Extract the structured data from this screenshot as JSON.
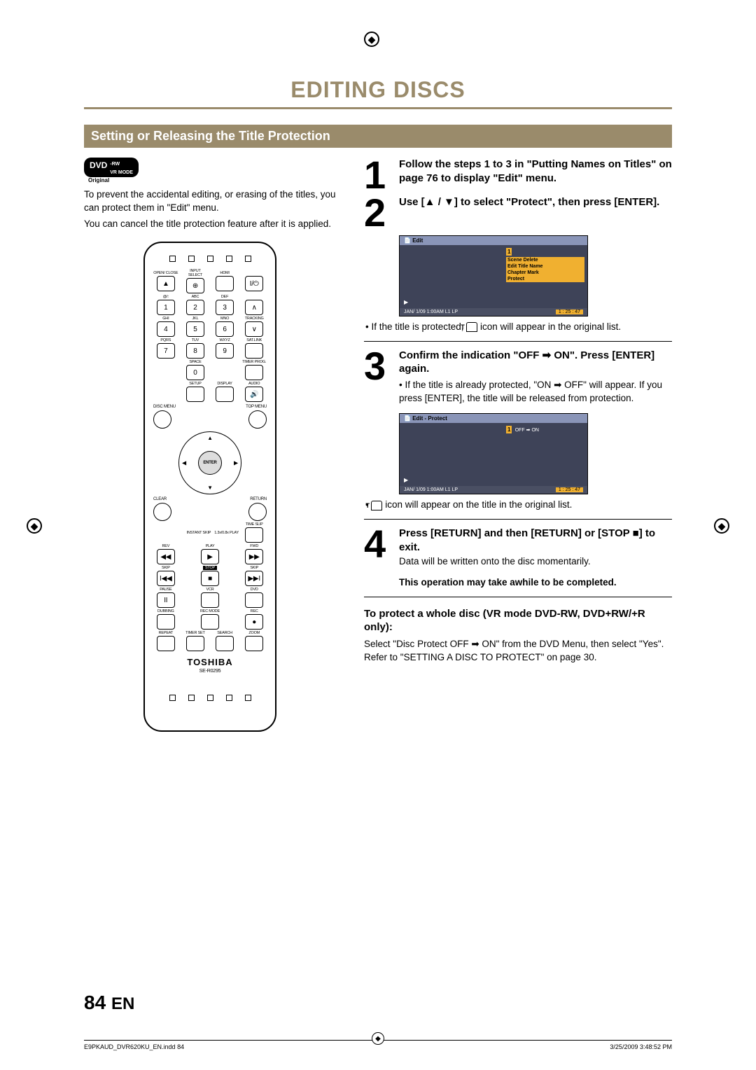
{
  "header": {
    "title": "EDITING DISCS"
  },
  "section_bar": "Setting or Releasing the Title Protection",
  "dvd_badge": {
    "top": "DVD",
    "mid": "-RW",
    "bot": "VR MODE",
    "sub": "Original"
  },
  "intro": {
    "p1": "To prevent the accidental editing, or erasing of the titles, you can protect them in \"Edit\" menu.",
    "p2": "You can cancel the title protection feature after it is applied."
  },
  "remote": {
    "row_labels": [
      "OPEN/\nCLOSE",
      "INPUT\nSELECT",
      "HDMI",
      ""
    ],
    "abc": [
      "@/:",
      "ABC",
      "DEF",
      ""
    ],
    "nums1": [
      "1",
      "2",
      "3"
    ],
    "ghi": [
      "GHI",
      "JKL",
      "MNO",
      "TRACKING"
    ],
    "nums2": [
      "4",
      "5",
      "6"
    ],
    "pqrs": [
      "PQRS",
      "TUV",
      "WXYZ",
      "SAT.LINK"
    ],
    "nums3": [
      "7",
      "8",
      "9"
    ],
    "zero_row": [
      "",
      "SPACE",
      "",
      "TIMER\nPROG."
    ],
    "zero": "0",
    "setup_row": [
      "",
      "SETUP",
      "DISPLAY",
      "AUDIO"
    ],
    "disc_menu": "DISC MENU",
    "top_menu": "TOP MENU",
    "enter": "ENTER",
    "clear": "CLEAR",
    "return": "RETURN",
    "instant": "INSTANT\nSKIP",
    "play13": "1.3x/0.8x\nPLAY",
    "timeslip": "TIME SLIP",
    "rev": "REV",
    "play": "PLAY",
    "fwd": "FWD",
    "skip1": "SKIP",
    "stop": "STOP",
    "skip2": "SKIP",
    "pause": "PAUSE",
    "vcr": "VCR",
    "dvd": "DVD",
    "dubbing": "DUBBING",
    "recmode": "REC MODE",
    "rec": "REC",
    "repeat": "REPEAT",
    "timerset": "TIMER SET",
    "search": "SEARCH",
    "zoom": "ZOOM",
    "brand": "TOSHIBA",
    "model": "SE-R0295"
  },
  "steps": [
    {
      "n": "1",
      "bold": "Follow the steps 1 to 3 in \"Putting Names on Titles\" on page 76 to display \"Edit\" menu."
    },
    {
      "n": "2",
      "bold": "Use [▲ / ▼] to select \"Protect\", then press [ENTER]."
    },
    {
      "n": "3",
      "bold": "Confirm the indication \"OFF ➡ ON\". Press [ENTER] again."
    },
    {
      "n": "4",
      "bold": "Press [RETURN] and then [RETURN] or [STOP ■] to exit."
    }
  ],
  "osd1": {
    "hdr": "Edit",
    "chip": "1",
    "items": [
      "Scene Delete",
      "Edit Title Name",
      "Chapter Mark",
      "Protect"
    ],
    "ftr_l": "JAN/ 1/09 1:00AM L1   LP",
    "ftr_r": "1 : 25 : 47"
  },
  "after_osd1": "If the title is protected,       icon will appear in the original list.",
  "after_osd1_iconword": "",
  "step3_bullet": "If the title is already protected, \"ON ➡ OFF\" will appear. If you press [ENTER], the title will be released from protection.",
  "osd2": {
    "hdr": "Edit - Protect",
    "chip": "1",
    "item": "OFF  ➡  ON",
    "ftr_l": "JAN/ 1/09 1:00AM L1   LP",
    "ftr_r": "1 : 25 : 47"
  },
  "after_osd2": "       icon will appear on the title in the original list.",
  "step4_body": "Data will be written onto the disc momentarily.",
  "note": "This operation may take awhile to be completed.",
  "sub_heading": "To protect a whole disc (VR mode DVD-RW, DVD+RW/+R only):",
  "sub_body1": "Select \"Disc Protect OFF ➡ ON\" from the DVD Menu, then select \"Yes\".",
  "sub_body2": "Refer to \"SETTING A DISC TO PROTECT\" on page 30.",
  "page_num": "84",
  "page_lang": "EN",
  "footer": {
    "l": "E9PKAUD_DVR620KU_EN.indd   84",
    "r": "3/25/2009   3:48:52 PM"
  }
}
